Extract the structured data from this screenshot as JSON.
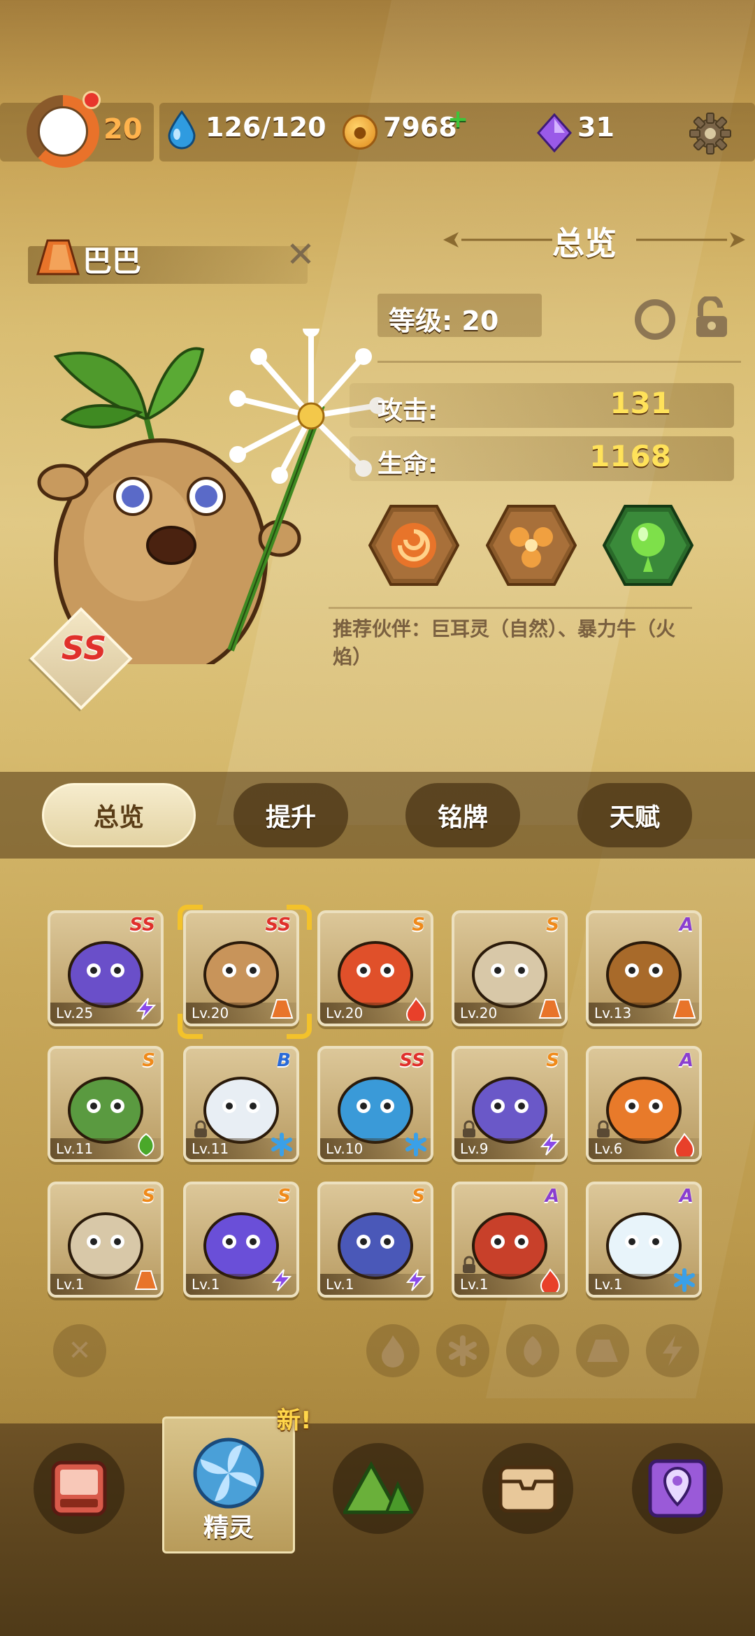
{
  "topbar": {
    "player_level": "20",
    "energy": "126/120",
    "coins": "7968",
    "gems": "31"
  },
  "pet": {
    "name": "巴巴",
    "rank": "SS"
  },
  "overview": {
    "title": "总览",
    "level_text": "等级: 20",
    "attack_label": "攻击:",
    "attack_value": "131",
    "hp_label": "生命:",
    "hp_value": "1168",
    "recommend": "推荐伙伴：巨耳灵（自然）、暴力牛（火焰）"
  },
  "tabs": [
    {
      "label": "总览",
      "active": true
    },
    {
      "label": "提升",
      "active": false
    },
    {
      "label": "铭牌",
      "active": false
    },
    {
      "label": "天赋",
      "active": false
    }
  ],
  "cards": [
    {
      "rarity": "SS",
      "level": "Lv.25",
      "element": "lightning-icon",
      "color": "#6a4fc9"
    },
    {
      "rarity": "SS",
      "level": "Lv.20",
      "element": "earth-icon",
      "color": "#c8945a",
      "selected": true
    },
    {
      "rarity": "S",
      "level": "Lv.20",
      "element": "fire-icon",
      "color": "#e0502a"
    },
    {
      "rarity": "S",
      "level": "Lv.20",
      "element": "earth-icon",
      "color": "#d8c8a8"
    },
    {
      "rarity": "A",
      "level": "Lv.13",
      "element": "earth-icon",
      "color": "#a86a2a"
    },
    {
      "rarity": "S",
      "level": "Lv.11",
      "element": "nature-icon",
      "color": "#5a9a40"
    },
    {
      "rarity": "B",
      "level": "Lv.11",
      "element": "ice-icon",
      "color": "#e8eef4",
      "locked": true
    },
    {
      "rarity": "SS",
      "level": "Lv.10",
      "element": "ice-icon",
      "color": "#3a9ad8"
    },
    {
      "rarity": "S",
      "level": "Lv.9",
      "element": "lightning-icon",
      "color": "#6a58c8",
      "locked": true
    },
    {
      "rarity": "A",
      "level": "Lv.6",
      "element": "fire-icon",
      "color": "#e87a2a",
      "locked": true
    },
    {
      "rarity": "S",
      "level": "Lv.1",
      "element": "earth-icon",
      "color": "#d8c8a8"
    },
    {
      "rarity": "S",
      "level": "Lv.1",
      "element": "lightning-icon",
      "color": "#6a4fd8"
    },
    {
      "rarity": "S",
      "level": "Lv.1",
      "element": "lightning-icon",
      "color": "#4a58b8"
    },
    {
      "rarity": "A",
      "level": "Lv.1",
      "element": "fire-icon",
      "color": "#c8402a",
      "locked": true
    },
    {
      "rarity": "A",
      "level": "Lv.1",
      "element": "ice-icon",
      "color": "#e8f4fa"
    }
  ],
  "rarity_colors": {
    "SS": "#e0302b",
    "S": "#f08a1a",
    "A": "#8a3fd0",
    "B": "#2a6ad8"
  },
  "bottom_nav": {
    "active_label": "精灵",
    "new_badge": "新!"
  }
}
